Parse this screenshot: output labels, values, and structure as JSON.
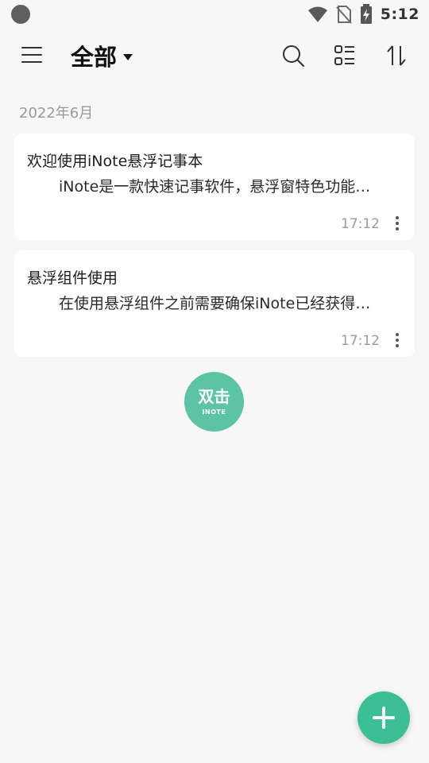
{
  "status_bar": {
    "time": "5:12",
    "icons": [
      "wifi-icon",
      "no-sim-icon",
      "battery-charging-icon"
    ]
  },
  "toolbar": {
    "title": "全部",
    "icons": [
      "menu-icon",
      "dropdown-caret-icon",
      "search-icon",
      "list-view-icon",
      "sort-icon"
    ]
  },
  "section": {
    "label": "2022年6月"
  },
  "notes": [
    {
      "title": "欢迎使用iNote悬浮记事本",
      "preview": "iNote是一款快速记事软件，悬浮窗特色功能…",
      "time": "17:12"
    },
    {
      "title": "悬浮组件使用",
      "preview": "在使用悬浮组件之前需要确保iNote已经获得…",
      "time": "17:12"
    }
  ],
  "float_widget": {
    "main": "双击",
    "sub": "INOTE"
  },
  "fab": {
    "icon": "plus-icon"
  },
  "colors": {
    "accent": "#3dbf96",
    "widget": "#5cc3a5",
    "background": "#f7f7f7"
  }
}
